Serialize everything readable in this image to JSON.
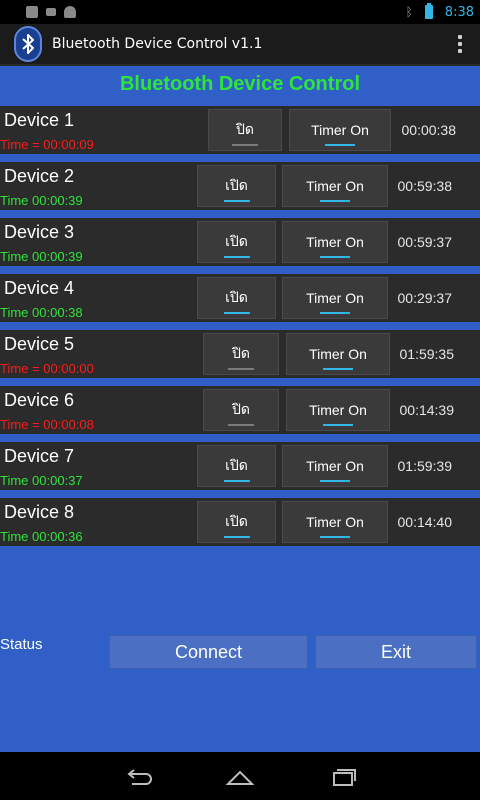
{
  "status_bar": {
    "time": "8:38"
  },
  "action_bar": {
    "title": "Bluetooth Device Control v1.1"
  },
  "header": {
    "title": "Bluetooth Device Control"
  },
  "devices": [
    {
      "name": "Device 1",
      "time_text": "Time = 00:00:09",
      "time_color": "red",
      "toggle_label": "ปิด",
      "timer_label": "Timer On",
      "countdown": "00:00:38"
    },
    {
      "name": "Device 2",
      "time_text": "Time 00:00:39",
      "time_color": "green",
      "toggle_label": "เปิด",
      "timer_label": "Timer On",
      "countdown": "00:59:38"
    },
    {
      "name": "Device 3",
      "time_text": "Time 00:00:39",
      "time_color": "green",
      "toggle_label": "เปิด",
      "timer_label": "Timer On",
      "countdown": "00:59:37"
    },
    {
      "name": "Device 4",
      "time_text": "Time 00:00:38",
      "time_color": "green",
      "toggle_label": "เปิด",
      "timer_label": "Timer On",
      "countdown": "00:29:37"
    },
    {
      "name": "Device 5",
      "time_text": "Time = 00:00:00",
      "time_color": "red",
      "toggle_label": "ปิด",
      "timer_label": "Timer On",
      "countdown": "01:59:35"
    },
    {
      "name": "Device 6",
      "time_text": "Time = 00:00:08",
      "time_color": "red",
      "toggle_label": "ปิด",
      "timer_label": "Timer On",
      "countdown": "00:14:39"
    },
    {
      "name": "Device 7",
      "time_text": "Time 00:00:37",
      "time_color": "green",
      "toggle_label": "เปิด",
      "timer_label": "Timer On",
      "countdown": "01:59:39"
    },
    {
      "name": "Device 8",
      "time_text": "Time 00:00:36",
      "time_color": "green",
      "toggle_label": "เปิด",
      "timer_label": "Timer On",
      "countdown": "00:14:40"
    }
  ],
  "footer": {
    "status_label": "Status",
    "connect_label": "Connect",
    "exit_label": "Exit"
  },
  "colors": {
    "background": "#2f5fc7",
    "title_green": "#2ee43a",
    "alert_red": "#ff1a1a",
    "accent_blue": "#33b5e5"
  }
}
